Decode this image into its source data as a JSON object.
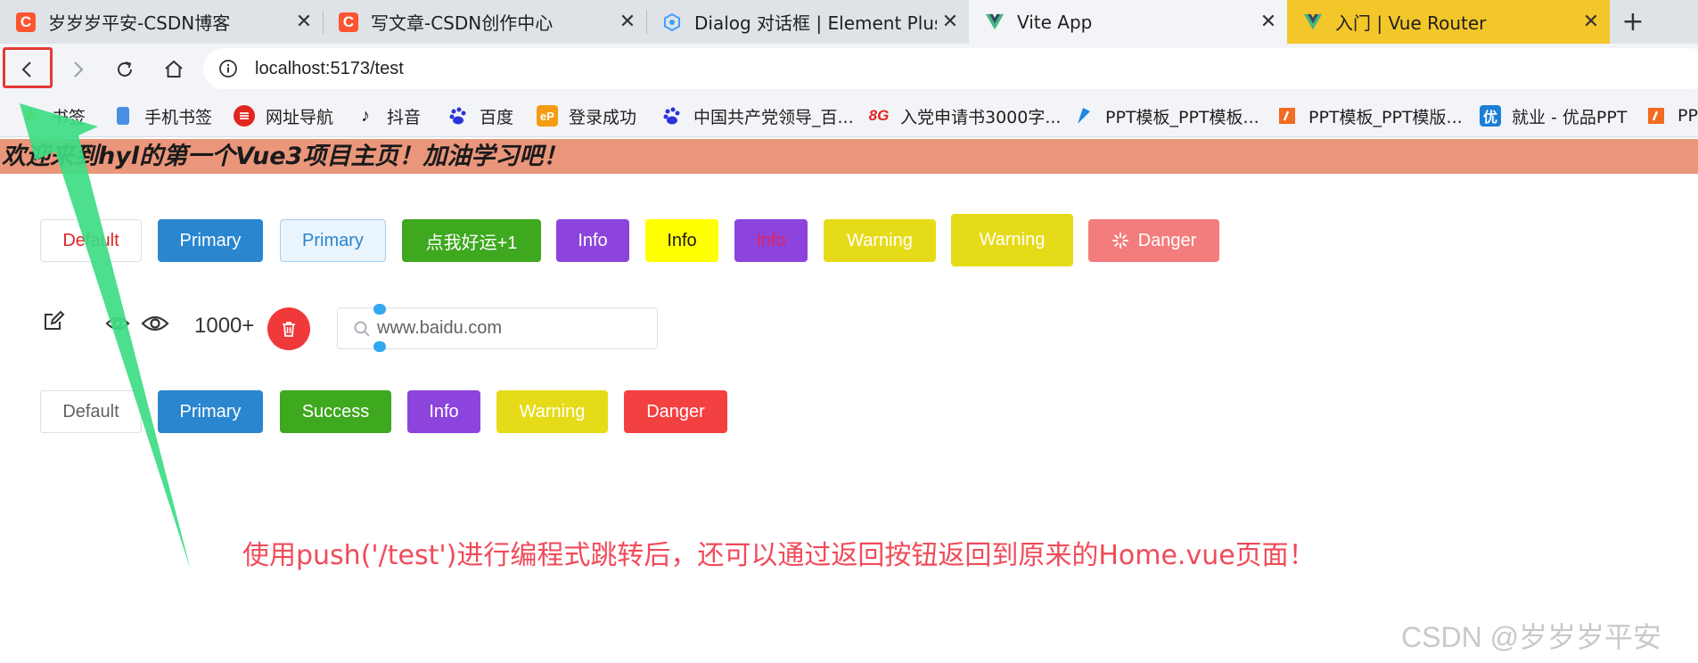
{
  "tabs": [
    {
      "title": "岁岁岁平安-CSDN博客",
      "icon": "csdn-icon",
      "state": "inactive"
    },
    {
      "title": "写文章-CSDN创作中心",
      "icon": "csdn-icon",
      "state": "inactive"
    },
    {
      "title": "Dialog 对话框 | Element Plus",
      "icon": "element-plus-icon",
      "state": "inactive"
    },
    {
      "title": "Vite App",
      "icon": "vue-icon",
      "state": "active"
    },
    {
      "title": "入门 | Vue Router",
      "icon": "vue-icon",
      "state": "inactive"
    }
  ],
  "tab_close_glyph": "✕",
  "new_tab_glyph": "+",
  "address": {
    "url": "localhost:5173/test"
  },
  "bookmarks": [
    {
      "label": "书签",
      "icon": "star-icon"
    },
    {
      "label": "手机书签",
      "icon": "phone-icon"
    },
    {
      "label": "网址导航",
      "icon": "nav-icon"
    },
    {
      "label": "抖音",
      "icon": "tiktok-icon"
    },
    {
      "label": "百度",
      "icon": "baidu-icon"
    },
    {
      "label": "登录成功",
      "icon": "ep-icon",
      "icon_text": "eP"
    },
    {
      "label": "中国共产党领导_百...",
      "icon": "baidu-icon"
    },
    {
      "label": "入党申请书3000字...",
      "icon": "86-icon",
      "icon_text": "8G"
    },
    {
      "label": "PPT模板_PPT模板...",
      "icon": "ppt-blue-icon"
    },
    {
      "label": "PPT模板_PPT模版...",
      "icon": "ppt-orange-icon"
    },
    {
      "label": "就业 - 优品PPT",
      "icon": "youpin-icon",
      "icon_text": "优"
    },
    {
      "label": "PP",
      "icon": "ppt-orange-icon"
    }
  ],
  "page": {
    "heading": "欢迎来到hyl的第一个Vue3项目主页！加油学习吧！",
    "row1": [
      {
        "label": "Default",
        "variant": "default-red-text"
      },
      {
        "label": "Primary",
        "variant": "primary"
      },
      {
        "label": "Primary",
        "variant": "primary-plain"
      },
      {
        "label": "点我好运+1",
        "variant": "success"
      },
      {
        "label": "Info",
        "variant": "info"
      },
      {
        "label": "Info",
        "variant": "yellow"
      },
      {
        "label": "Info",
        "variant": "info-red-text"
      },
      {
        "label": "Warning",
        "variant": "warning"
      },
      {
        "label": "Warning",
        "variant": "warning-large"
      },
      {
        "label": "Danger",
        "variant": "danger-loading"
      }
    ],
    "badge_value": "1000+",
    "search_value": "www.baidu.com",
    "row3": [
      {
        "label": "Default",
        "variant": "default"
      },
      {
        "label": "Primary",
        "variant": "primary"
      },
      {
        "label": "Success",
        "variant": "success"
      },
      {
        "label": "Info",
        "variant": "info"
      },
      {
        "label": "Warning",
        "variant": "warning"
      },
      {
        "label": "Danger",
        "variant": "danger"
      }
    ],
    "annotation": "使用push('/test')进行编程式跳转后，还可以通过返回按钮返回到原来的Home.vue页面！",
    "watermark": "CSDN @岁岁岁平安"
  },
  "colors": {
    "banner_bg": "#ea967b",
    "primary": "#2a86cf",
    "success": "#3ea81f",
    "info": "#8c44dc",
    "warning": "#e6db19",
    "danger": "#f34040",
    "annotation_text": "#f04b5a",
    "arrow": "#3ddc84",
    "highlight_box": "#e53935"
  }
}
